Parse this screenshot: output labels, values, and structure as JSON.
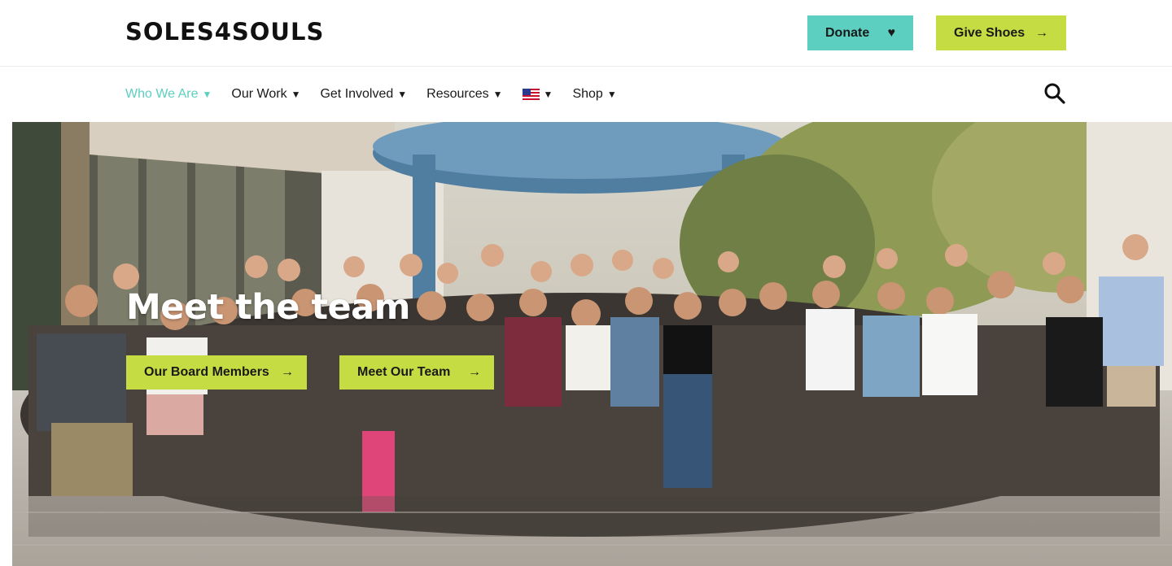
{
  "header": {
    "logo_text": "SOLES4SOULS",
    "donate_label": "Donate",
    "donate_icon": "heart-icon",
    "give_label": "Give Shoes",
    "give_icon": "arrow-right-icon"
  },
  "nav": {
    "items": [
      {
        "label": "Who We Are",
        "active": true
      },
      {
        "label": "Our Work"
      },
      {
        "label": "Get Involved"
      },
      {
        "label": "Resources"
      },
      {
        "label": "",
        "icon": "us-flag-icon"
      },
      {
        "label": "Shop"
      }
    ],
    "caret": "▼",
    "search_icon": "search-icon"
  },
  "hero": {
    "title": "Meet the team",
    "buttons": [
      {
        "label": "Our Board Members",
        "icon": "arrow-right-icon"
      },
      {
        "label": "Meet Our Team",
        "icon": "arrow-right-icon"
      }
    ]
  },
  "colors": {
    "teal": "#5ccfc0",
    "lime": "#c6dc43",
    "text": "#1a1a1a"
  }
}
